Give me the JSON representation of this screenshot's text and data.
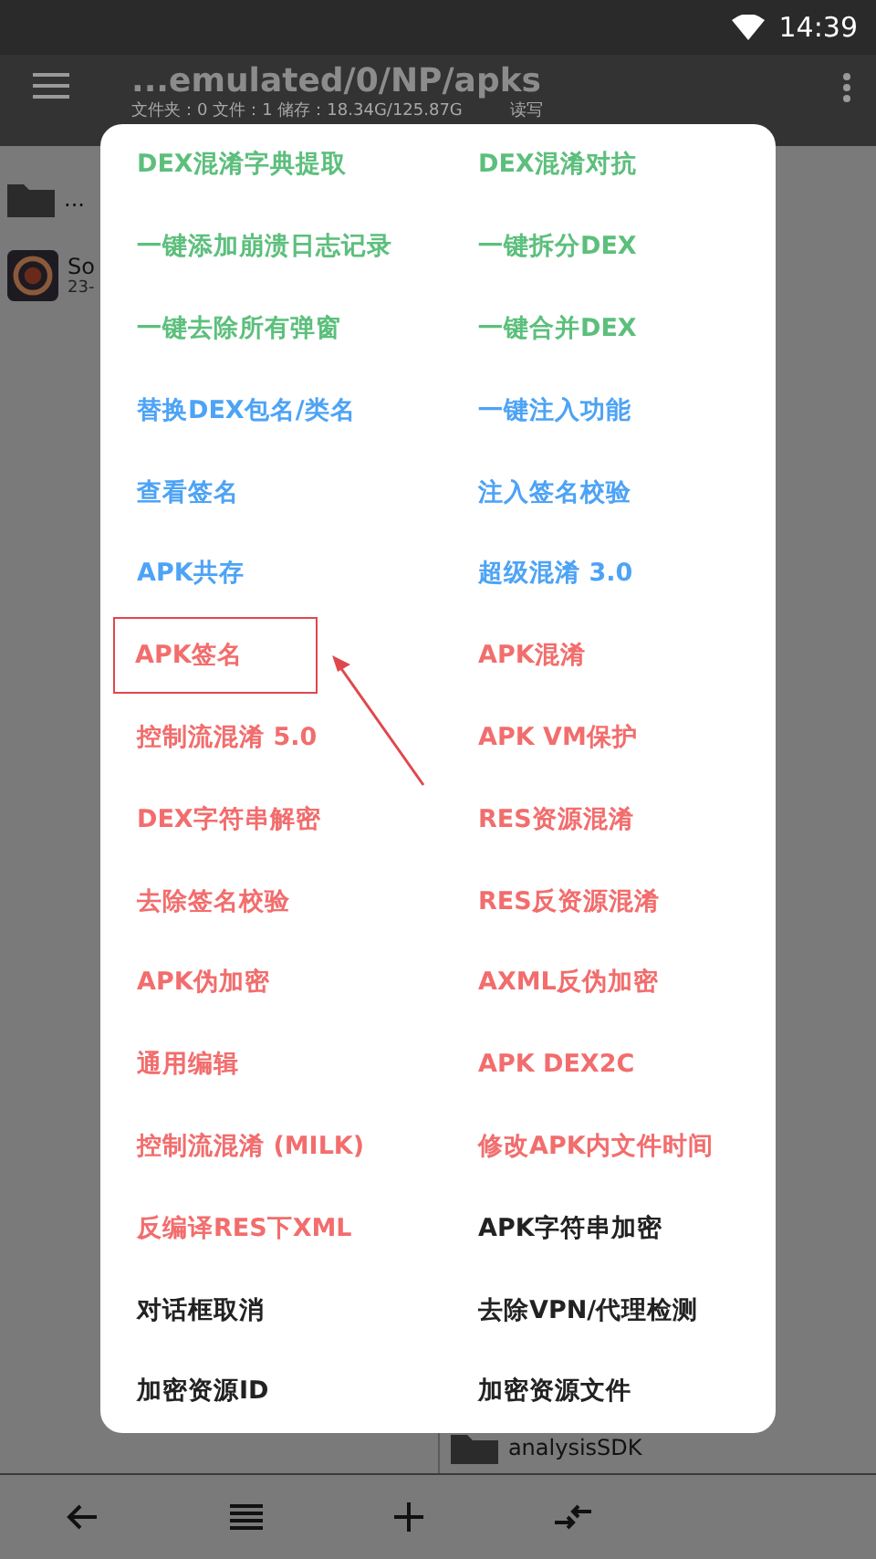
{
  "status_bar": {
    "time": "14:39"
  },
  "toolbar": {
    "title": "...emulated/0/NP/apks",
    "subtitle": "文件夹：0  文件：1  储存：18.34G/125.87G",
    "access": "读写"
  },
  "left_pane": {
    "items": [
      {
        "kind": "folder",
        "name": "..."
      },
      {
        "kind": "app",
        "name": "So",
        "meta": "23-"
      }
    ]
  },
  "right_pane": {
    "items": [
      {
        "kind": "folder",
        "name": "analysisSDK"
      }
    ]
  },
  "dialog": {
    "items": [
      {
        "label": "DEX混淆字典提取",
        "color": "#5cbf7c",
        "highlighted": false
      },
      {
        "label": "DEX混淆对抗",
        "color": "#5cbf7c",
        "highlighted": false
      },
      {
        "label": "一键添加崩溃日志记录",
        "color": "#5cbf7c",
        "highlighted": false
      },
      {
        "label": "一键拆分DEX",
        "color": "#5cbf7c",
        "highlighted": false
      },
      {
        "label": "一键去除所有弹窗",
        "color": "#5cbf7c",
        "highlighted": false
      },
      {
        "label": "一键合并DEX",
        "color": "#5cbf7c",
        "highlighted": false
      },
      {
        "label": "替换DEX包名/类名",
        "color": "#4da3f5",
        "highlighted": false
      },
      {
        "label": "一键注入功能",
        "color": "#4da3f5",
        "highlighted": false
      },
      {
        "label": "查看签名",
        "color": "#4da3f5",
        "highlighted": false
      },
      {
        "label": "注入签名校验",
        "color": "#4da3f5",
        "highlighted": false
      },
      {
        "label": "APK共存",
        "color": "#4da3f5",
        "highlighted": false
      },
      {
        "label": "超级混淆 3.0",
        "color": "#4da3f5",
        "highlighted": false
      },
      {
        "label": "APK签名",
        "color": "#f26d6d",
        "highlighted": true
      },
      {
        "label": "APK混淆",
        "color": "#f26d6d",
        "highlighted": false
      },
      {
        "label": "控制流混淆 5.0",
        "color": "#f26d6d",
        "highlighted": false
      },
      {
        "label": "APK VM保护",
        "color": "#f26d6d",
        "highlighted": false
      },
      {
        "label": "DEX字符串解密",
        "color": "#f26d6d",
        "highlighted": false
      },
      {
        "label": "RES资源混淆",
        "color": "#f26d6d",
        "highlighted": false
      },
      {
        "label": "去除签名校验",
        "color": "#f26d6d",
        "highlighted": false
      },
      {
        "label": "RES反资源混淆",
        "color": "#f26d6d",
        "highlighted": false
      },
      {
        "label": "APK伪加密",
        "color": "#f26d6d",
        "highlighted": false
      },
      {
        "label": "AXML反伪加密",
        "color": "#f26d6d",
        "highlighted": false
      },
      {
        "label": "通用编辑",
        "color": "#f26d6d",
        "highlighted": false
      },
      {
        "label": "APK DEX2C",
        "color": "#f26d6d",
        "highlighted": false
      },
      {
        "label": "控制流混淆 (MILK)",
        "color": "#f26d6d",
        "highlighted": false
      },
      {
        "label": "修改APK内文件时间",
        "color": "#f26d6d",
        "highlighted": false
      },
      {
        "label": "反编译RES下XML",
        "color": "#f26d6d",
        "highlighted": false
      },
      {
        "label": "APK字符串加密",
        "color": "#222222",
        "highlighted": false
      },
      {
        "label": "对话框取消",
        "color": "#222222",
        "highlighted": false
      },
      {
        "label": "去除VPN/代理检测",
        "color": "#222222",
        "highlighted": false
      },
      {
        "label": "加密资源ID",
        "color": "#222222",
        "highlighted": false
      },
      {
        "label": "加密资源文件",
        "color": "#222222",
        "highlighted": false
      }
    ]
  }
}
